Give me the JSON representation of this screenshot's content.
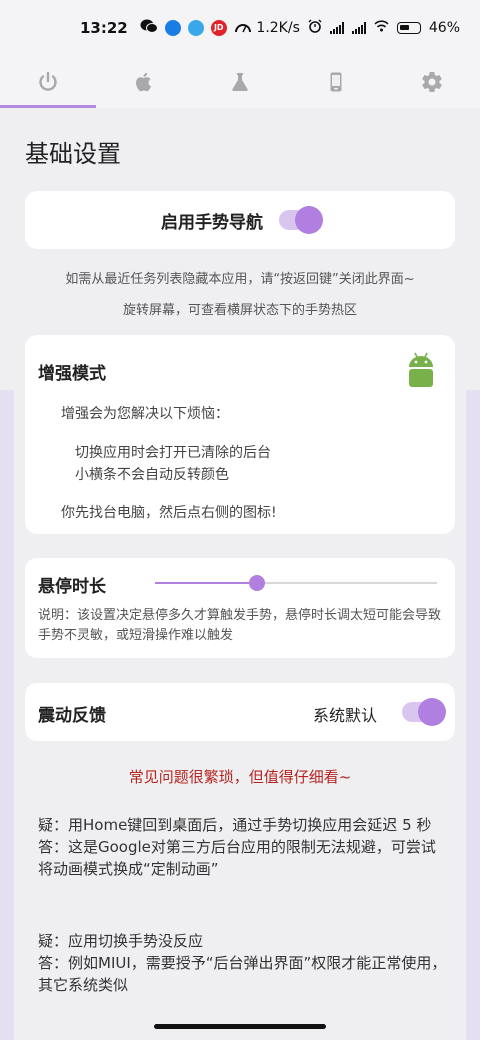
{
  "status_bar": {
    "time": "13:22",
    "network_speed": "1.2K/s",
    "battery": "46%",
    "app_badge": "JD"
  },
  "tabs": [
    {
      "name": "power-icon",
      "active": true
    },
    {
      "name": "apple-icon",
      "active": false
    },
    {
      "name": "flask-icon",
      "active": false
    },
    {
      "name": "phone-icon",
      "active": false
    },
    {
      "name": "gear-icon",
      "active": false
    }
  ],
  "page_title": "基础设置",
  "gesture_nav": {
    "label": "启用手势导航",
    "enabled": true
  },
  "hints": {
    "line1": "如需从最近任务列表隐藏本应用，请“按返回键”关闭此界面~",
    "line2": "旋转屏幕，可查看横屏状态下的手势热区"
  },
  "enhanced_mode": {
    "heading": "增强模式",
    "intro": "增强会为您解决以下烦恼：",
    "item1": "切换应用时会打开已清除的后台",
    "item2": "小横条不会自动反转颜色",
    "footer": "你先找台电脑，然后点右侧的图标!"
  },
  "hover_duration": {
    "heading": "悬停时长",
    "slider_fraction": 0.36,
    "description": "说明：该设置决定悬停多久才算触发手势，悬停时长调太短可能会导致手势不灵敏，或短滑操作难以触发"
  },
  "vibration": {
    "heading": "震动反馈",
    "value": "系统默认",
    "enabled": true
  },
  "warning": "常见问题很繁琐，但值得仔细看~",
  "faq": [
    {
      "q": "疑：用Home键回到桌面后，通过手势切换应用会延迟 5 秒",
      "a": "答：这是Google对第三方后台应用的限制无法规避，可尝试将动画模式换成“定制动画”"
    },
    {
      "q": "疑：应用切换手势没反应",
      "a": "答：例如MIUI，需要授予“后台弹出界面”权限才能正常使用，其它系统类似"
    }
  ],
  "colors": {
    "accent": "#b07fe0",
    "warning": "#b5251f",
    "android_green": "#78b14a"
  }
}
